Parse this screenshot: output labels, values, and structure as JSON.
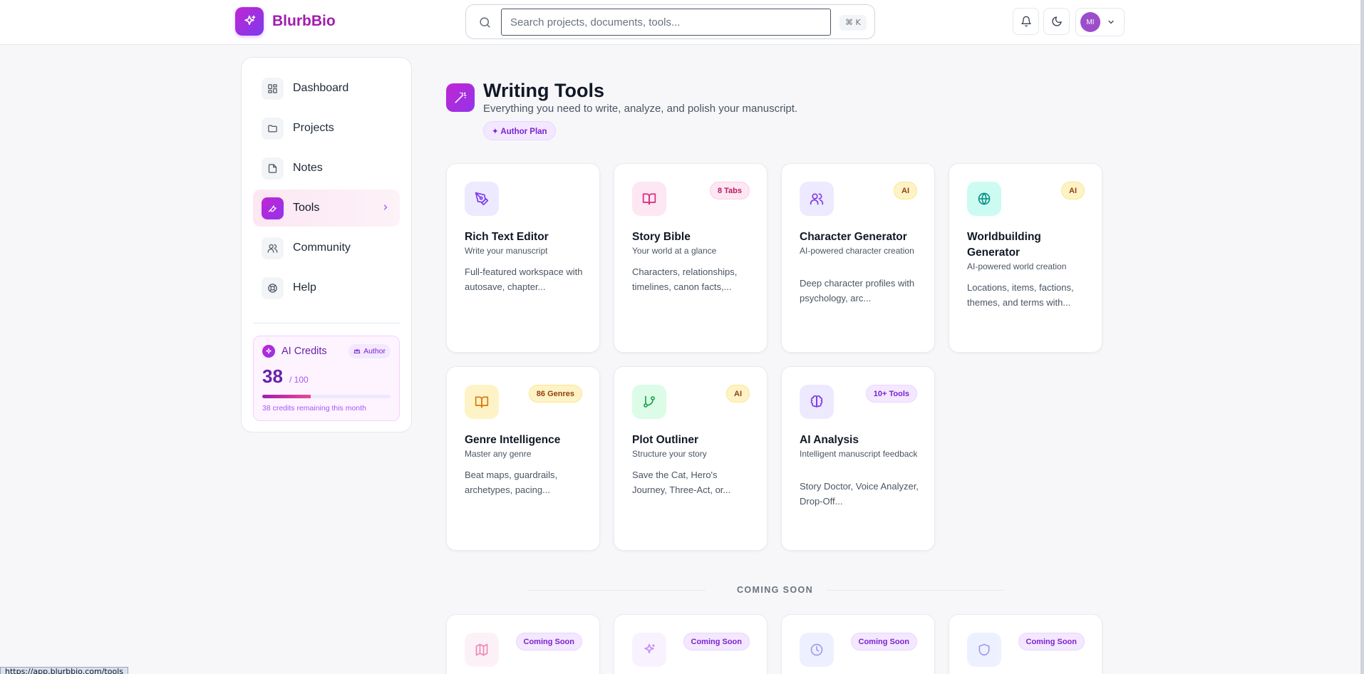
{
  "app": {
    "name": "BlurbBio"
  },
  "search": {
    "placeholder": "Search projects, documents, tools...",
    "shortcut": "⌘ K"
  },
  "user": {
    "initials": "MI"
  },
  "sidebar": {
    "items": [
      {
        "label": "Dashboard",
        "icon": "grid-icon"
      },
      {
        "label": "Projects",
        "icon": "folder-icon"
      },
      {
        "label": "Notes",
        "icon": "file-icon"
      },
      {
        "label": "Tools",
        "icon": "wrench-icon",
        "active": true
      },
      {
        "label": "Community",
        "icon": "users-icon"
      },
      {
        "label": "Help",
        "icon": "lifebuoy-icon"
      }
    ],
    "credits": {
      "title": "AI Credits",
      "plan_badge": "Author",
      "used": "38",
      "max": "/ 100",
      "fraction": 0.38,
      "note": "38 credits remaining this month"
    }
  },
  "page": {
    "title": "Writing Tools",
    "subtitle": "Everything you need to write, analyze, and polish your manuscript.",
    "plan_badge": "✦ Author Plan"
  },
  "tools": [
    {
      "title": "Rich Text Editor",
      "subtitle": "Write your manuscript",
      "description": "Full-featured workspace with autosave, chapter...",
      "badge": "",
      "icon": "pen-icon",
      "color": "#ede9fe"
    },
    {
      "title": "Story Bible",
      "subtitle": "Your world at a glance",
      "description": "Characters, relationships, timelines, canon facts,...",
      "badge": "8 Tabs",
      "icon": "book-open-icon",
      "color": "#fce7f3"
    },
    {
      "title": "Character Generator",
      "subtitle": "AI-powered character creation",
      "description": "Deep character profiles with psychology, arc...",
      "badge": "AI",
      "icon": "users-icon",
      "color": "#ede9fe"
    },
    {
      "title": "Worldbuilding Generator",
      "subtitle": "AI-powered world creation",
      "description": "Locations, items, factions, themes, and terms with...",
      "badge": "AI",
      "icon": "globe-icon",
      "color": "#ccfbf1"
    },
    {
      "title": "Genre Intelligence",
      "subtitle": "Master any genre",
      "description": "Beat maps, guardrails, archetypes, pacing...",
      "badge": "86 Genres",
      "icon": "book-open-icon",
      "color": "#fef3c7"
    },
    {
      "title": "Plot Outliner",
      "subtitle": "Structure your story",
      "description": "Save the Cat, Hero's Journey, Three-Act, or...",
      "badge": "AI",
      "icon": "git-branch-icon",
      "color": "#dcfce7"
    },
    {
      "title": "AI Analysis",
      "subtitle": "Intelligent manuscript feedback",
      "description": "Story Doctor, Voice Analyzer, Drop-Off...",
      "badge": "10+ Tools",
      "icon": "brain-icon",
      "color": "#ede9fe"
    }
  ],
  "coming_soon": {
    "label": "COMING SOON",
    "badge": "Coming Soon",
    "items": [
      {
        "icon": "map-icon",
        "color": "#fce7f3"
      },
      {
        "icon": "sparkles-icon",
        "color": "#f3e8ff"
      },
      {
        "icon": "clock-icon",
        "color": "#e0e7ff"
      },
      {
        "icon": "shield-icon",
        "color": "#e0e7ff"
      }
    ]
  },
  "status_bar": {
    "url": "https://app.blurbbio.com/tools"
  }
}
